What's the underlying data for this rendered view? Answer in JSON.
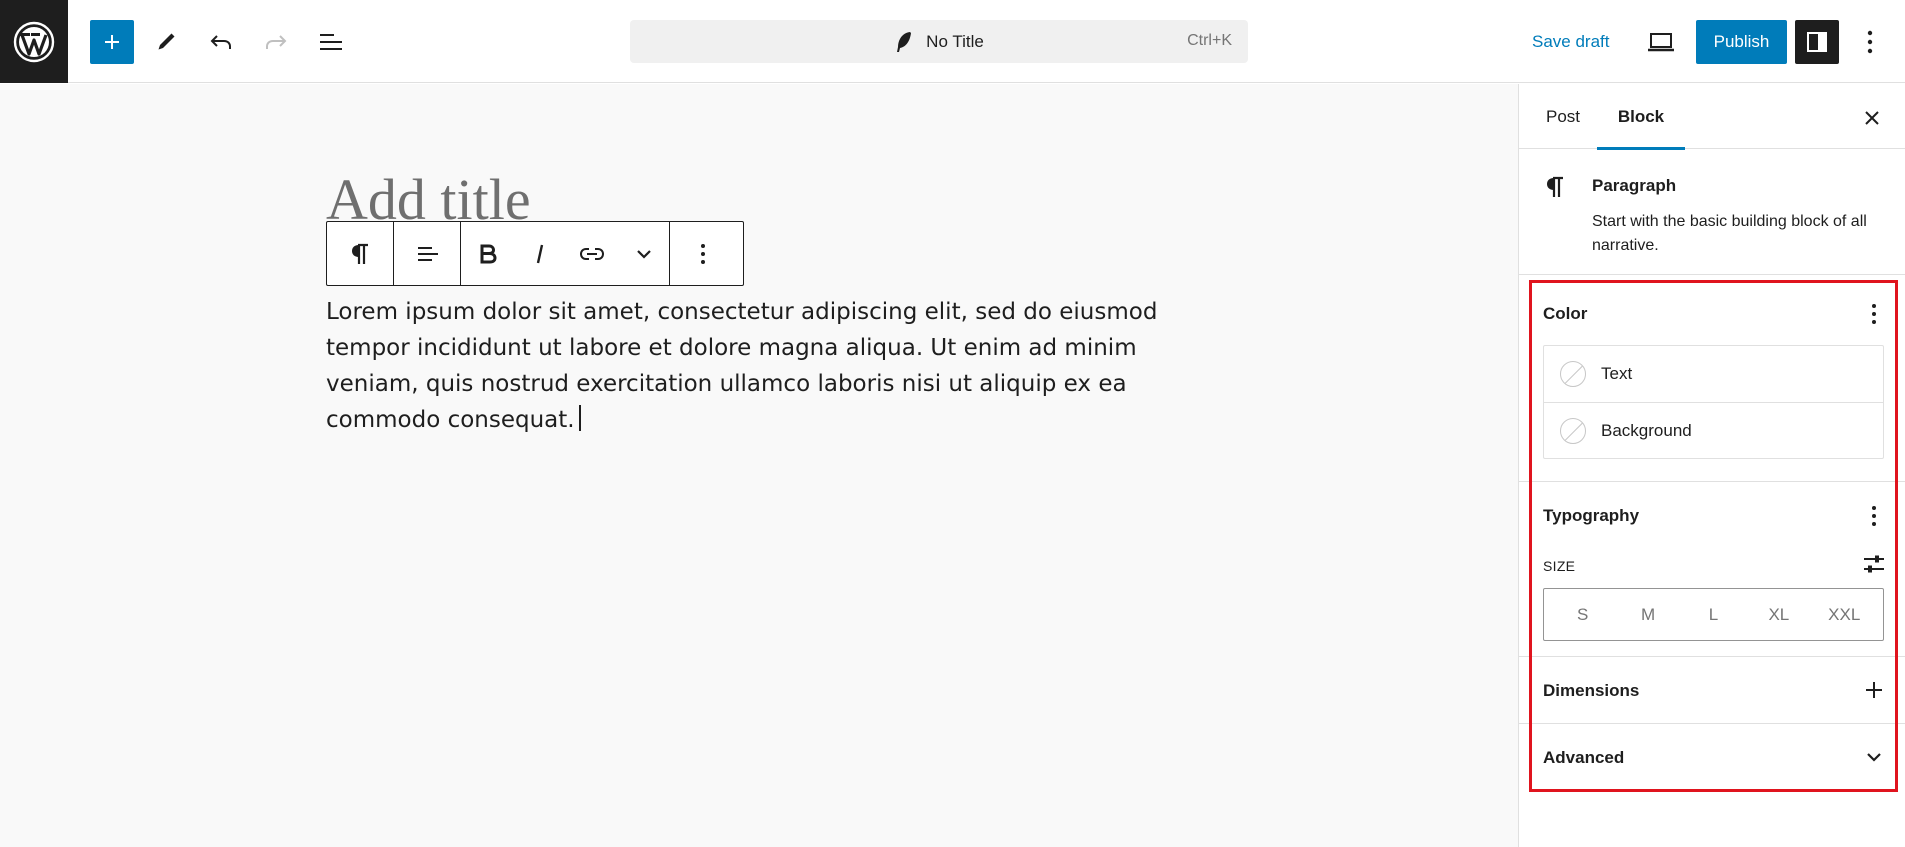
{
  "topbar": {
    "doc_title": "No Title",
    "shortcut": "Ctrl+K",
    "save_draft": "Save draft",
    "publish": "Publish",
    "icons": [
      "wordpress-logo",
      "plus-icon",
      "pencil-icon",
      "undo-icon",
      "redo-icon",
      "list-view-icon",
      "feather-icon",
      "desktop-preview-icon",
      "sidebar-icon",
      "more-vertical-icon"
    ]
  },
  "editor": {
    "title_placeholder": "Add title",
    "paragraph": "Lorem ipsum dolor sit amet, consectetur adipiscing elit, sed do eiusmod tempor incididunt ut labore et dolore magna aliqua. Ut enim ad minim veniam, quis nostrud exercitation ullamco laboris nisi ut aliquip ex ea commodo consequat."
  },
  "sidebar": {
    "tabs": [
      {
        "label": "Post",
        "active": false
      },
      {
        "label": "Block",
        "active": true
      }
    ],
    "block": {
      "name": "Paragraph",
      "description": "Start with the basic building block of all narrative."
    },
    "color": {
      "title": "Color",
      "items": [
        "Text",
        "Background"
      ]
    },
    "typography": {
      "title": "Typography",
      "size_label": "SIZE",
      "sizes": [
        "S",
        "M",
        "L",
        "XL",
        "XXL"
      ]
    },
    "dimensions": {
      "title": "Dimensions"
    },
    "advanced": {
      "title": "Advanced"
    }
  },
  "colors": {
    "accent": "#007cba",
    "dark": "#1e1e1e",
    "highlight": "#e0141e"
  }
}
